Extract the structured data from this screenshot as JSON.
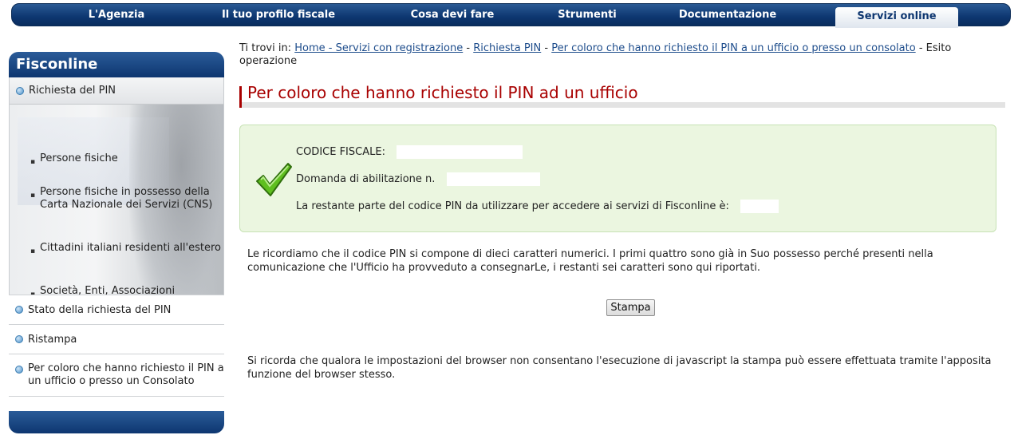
{
  "topnav": {
    "items": [
      "L'Agenzia",
      "Il tuo profilo fiscale",
      "Cosa devi fare",
      "Strumenti",
      "Documentazione",
      "Servizi online"
    ],
    "active": "Servizi online"
  },
  "sidebar": {
    "title": "Fisconline",
    "main_item": "Richiesta del PIN",
    "sub_items": [
      "Persone fisiche",
      "Persone fisiche in possesso della Carta Nazionale dei Servizi (CNS)",
      "Cittadini italiani residenti all'estero",
      "Società, Enti, Associazioni"
    ],
    "links": [
      "Stato della richiesta del PIN",
      "Ristampa",
      "Per coloro che hanno richiesto il PIN a un ufficio o presso un Consolato"
    ]
  },
  "breadcrumb": {
    "prefix": "Ti trovi in:",
    "links": [
      "Home - Servizi con registrazione",
      "Richiesta PIN",
      "Per coloro che hanno richiesto il PIN a un ufficio o presso un consolato"
    ],
    "separator": "-",
    "current": "Esito operazione"
  },
  "page_title": "Per coloro che hanno richiesto il PIN ad un ufficio",
  "result": {
    "codice_fiscale_label": "CODICE FISCALE:",
    "domanda_label": "Domanda di abilitazione n.",
    "pin_label": "La restante parte del codice PIN da utilizzare per accedere ai servizi di Fisconline è:"
  },
  "info_text": "Le ricordiamo che il codice PIN si compone di dieci caratteri numerici. I primi quattro sono già in Suo possesso perché presenti nella comunicazione che l'Ufficio ha provveduto a consegnarLe, i restanti sei caratteri sono qui riportati.",
  "print_button": "Stampa",
  "note_text": "Si ricorda che qualora le impostazioni del browser non consentano l'esecuzione di javascript la stampa può essere effettuata tramite l'apposita funzione del browser stesso.",
  "colors": {
    "nav_blue": "#0d3670",
    "title_red": "#a80000",
    "success_bg": "#ebf6e0",
    "link_blue": "#1e4d8c"
  }
}
